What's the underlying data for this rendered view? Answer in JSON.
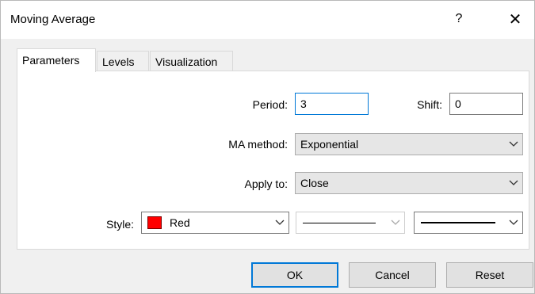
{
  "window": {
    "title": "Moving Average",
    "help_label": "?",
    "close_label": "✕"
  },
  "tabs": [
    {
      "label": "Parameters",
      "active": true
    },
    {
      "label": "Levels",
      "active": false
    },
    {
      "label": "Visualization",
      "active": false
    }
  ],
  "params": {
    "period_label": "Period:",
    "period_value": "3",
    "shift_label": "Shift:",
    "shift_value": "0",
    "method_label": "MA method:",
    "method_value": "Exponential",
    "apply_label": "Apply to:",
    "apply_value": "Close",
    "style_label": "Style:",
    "style_color_name": "Red",
    "style_color_hex": "#ff0000"
  },
  "buttons": {
    "ok": "OK",
    "cancel": "Cancel",
    "reset": "Reset"
  }
}
